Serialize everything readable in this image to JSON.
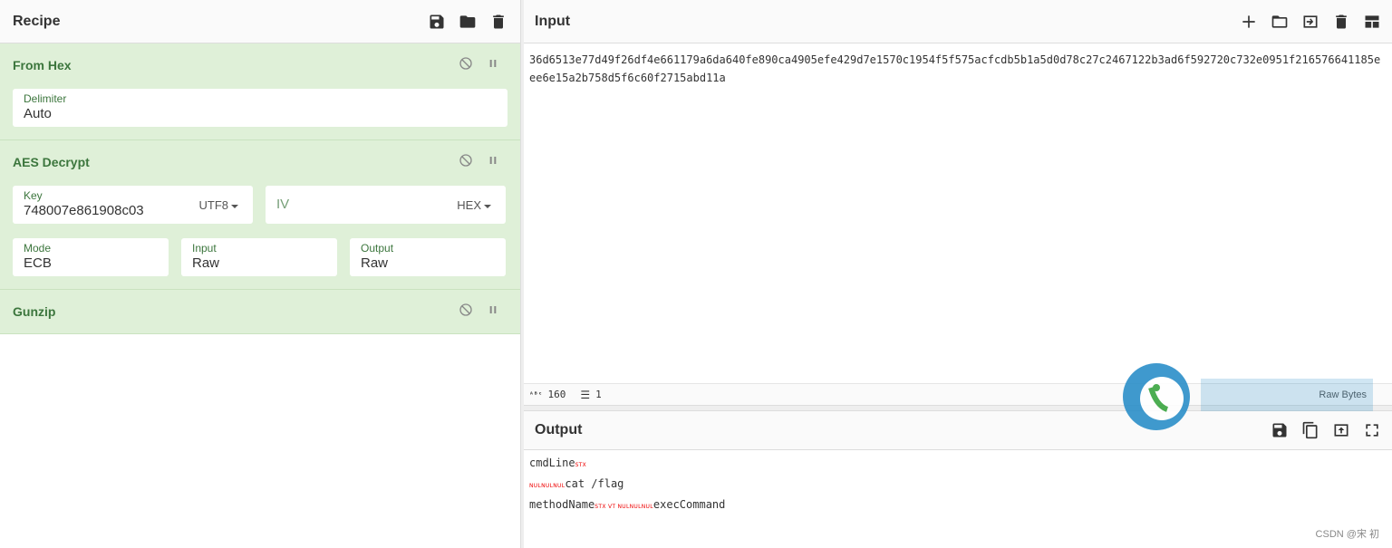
{
  "recipe": {
    "title": "Recipe",
    "operations": [
      {
        "name": "From Hex",
        "args": [
          {
            "label": "Delimiter",
            "value": "Auto"
          }
        ]
      },
      {
        "name": "AES Decrypt",
        "key": {
          "label": "Key",
          "value": "748007e861908c03",
          "encoding": "UTF8"
        },
        "iv": {
          "placeholder": "IV",
          "encoding": "HEX"
        },
        "mode": {
          "label": "Mode",
          "value": "ECB"
        },
        "input": {
          "label": "Input",
          "value": "Raw"
        },
        "output": {
          "label": "Output",
          "value": "Raw"
        }
      },
      {
        "name": "Gunzip"
      }
    ]
  },
  "input": {
    "title": "Input",
    "text": "36d6513e77d49f26df4e661179a6da640fe890ca4905efe429d7e1570c1954f5f575acfcdb5b1a5d0d78c27c2467122b3ad6f592720c732e0951f216576641185eee6e15a2b758d5f6c60f2715abd11a",
    "length": "160",
    "lines": "1",
    "raw_bytes": "Raw Bytes"
  },
  "output": {
    "title": "Output",
    "lines": [
      {
        "text": "cmdLine",
        "ctrl": "STX",
        "rest": ""
      },
      {
        "pre": "NULNULNUL",
        "text": "cat /flag"
      },
      {
        "text": "methodName",
        "ctrl": "STX VT NULNULNUL",
        "rest": "execCommand"
      }
    ]
  },
  "watermark": {
    "text": "CSDN @宋 初"
  },
  "colors": {
    "op_bg": "#dff0d8",
    "op_title": "#3c763d",
    "ctrl_char": "#e00000"
  }
}
